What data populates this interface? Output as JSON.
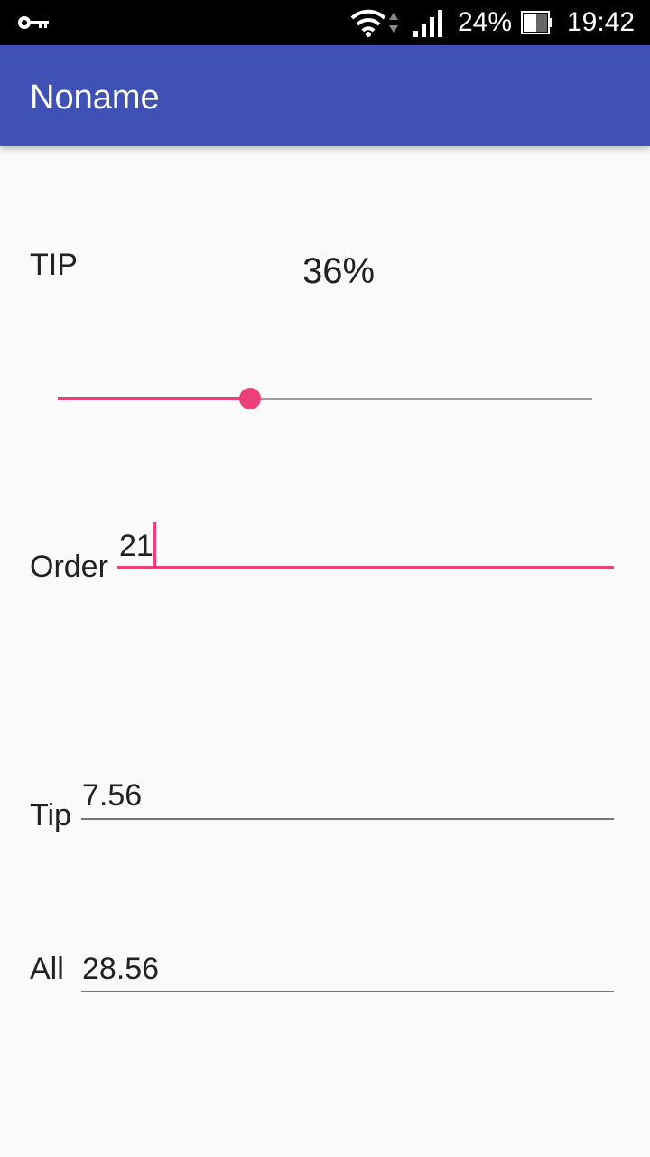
{
  "status_bar": {
    "battery_percent": "24%",
    "time": "19:42",
    "icons": [
      "key-icon",
      "wifi-icon",
      "data-updown-icon",
      "signal-icon",
      "battery-icon"
    ]
  },
  "app_bar": {
    "title": "Noname",
    "color": "#3f51b5"
  },
  "tip_section": {
    "label": "TIP",
    "percent_text": "36%",
    "slider_value_fraction": 0.36
  },
  "order": {
    "label": "Order",
    "value": "21"
  },
  "tip_amount": {
    "label": "Tip",
    "value": "7.56"
  },
  "all_amount": {
    "label": "All",
    "value": "28.56"
  },
  "colors": {
    "accent": "#ec407a",
    "primary": "#3f51b5",
    "background": "#fafafa"
  }
}
